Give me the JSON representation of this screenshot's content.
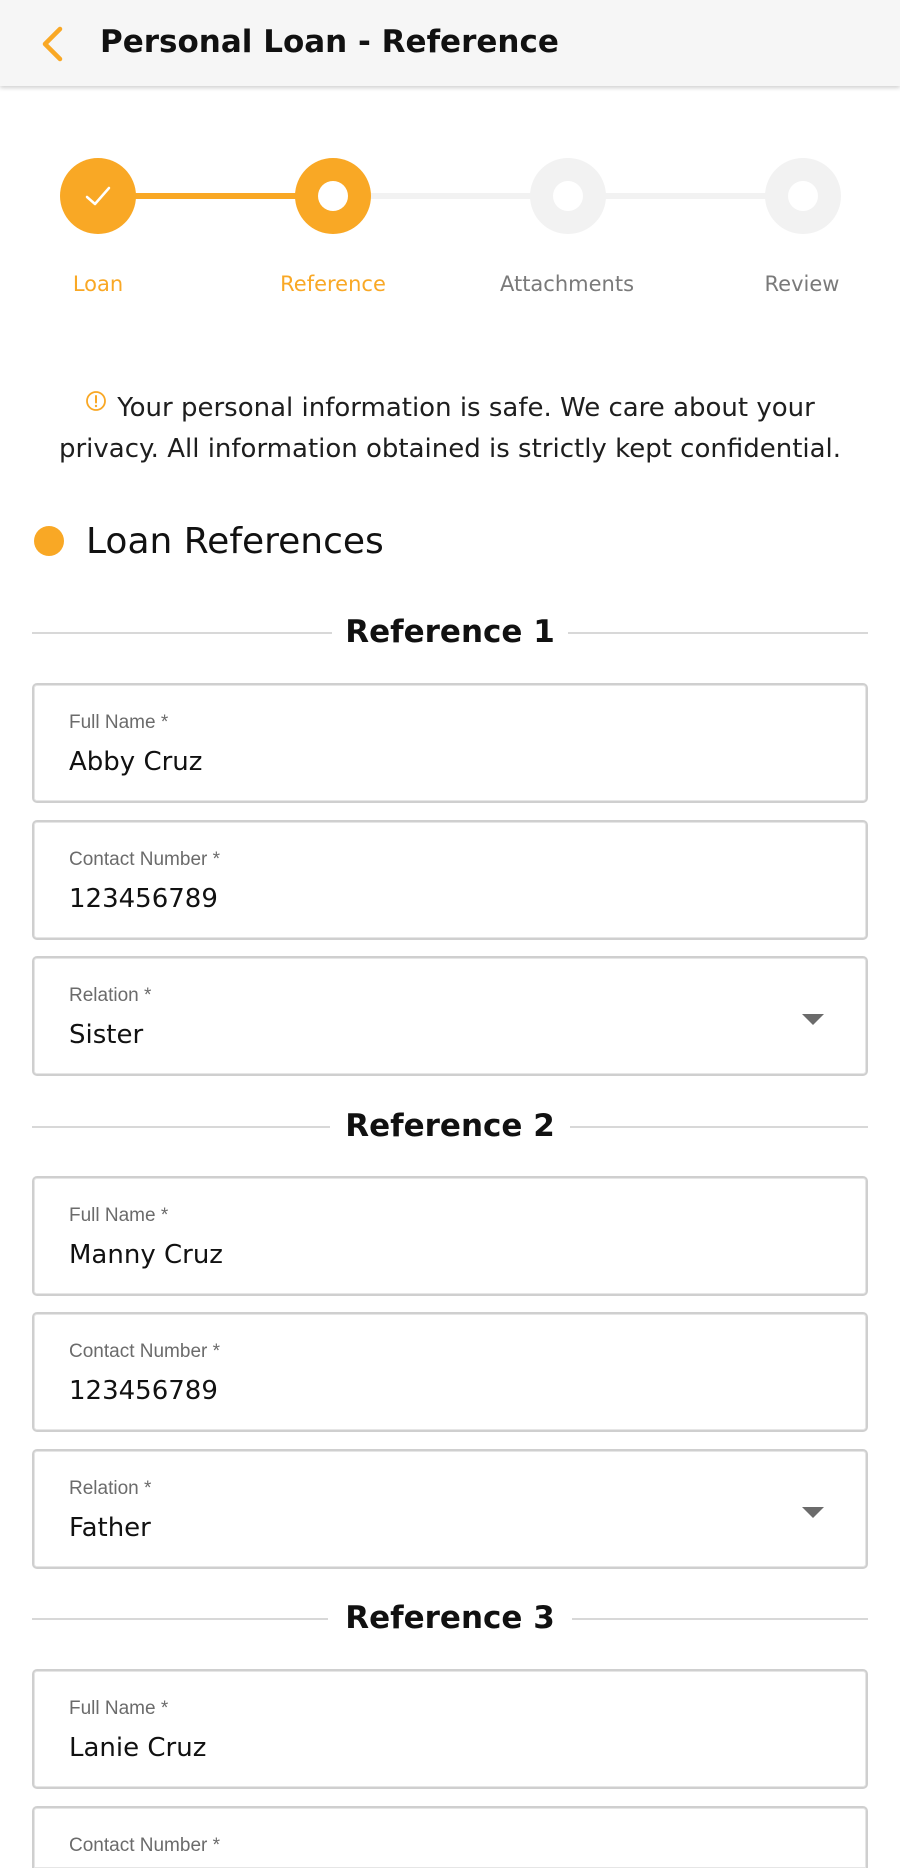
{
  "appbar": {
    "title": "Personal Loan - Reference",
    "back_icon": "chevron-left-icon",
    "accent_color": "#f9a825"
  },
  "stepper": {
    "active_color": "#f9a825",
    "inactive_color": "#f2f2f2",
    "steps": [
      {
        "label": "Loan",
        "state": "completed"
      },
      {
        "label": "Reference",
        "state": "current"
      },
      {
        "label": "Attachments",
        "state": "pending"
      },
      {
        "label": "Review",
        "state": "pending"
      }
    ]
  },
  "notice": {
    "icon": "info-circle-icon",
    "text": "Your personal information is safe. We care about your privacy. All information obtained is strictly kept confidential."
  },
  "section": {
    "title": "Loan References"
  },
  "references": [
    {
      "heading": "Reference 1",
      "full_name_label": "Full Name *",
      "full_name": "Abby Cruz",
      "contact_label": "Contact Number *",
      "contact": "123456789",
      "relation_label": "Relation *",
      "relation": "Sister"
    },
    {
      "heading": "Reference 2",
      "full_name_label": "Full Name *",
      "full_name": "Manny Cruz",
      "contact_label": "Contact Number *",
      "contact": "123456789",
      "relation_label": "Relation *",
      "relation": "Father"
    },
    {
      "heading": "Reference 3",
      "full_name_label": "Full Name *",
      "full_name": "Lanie Cruz",
      "contact_label": "Contact Number *"
    }
  ]
}
